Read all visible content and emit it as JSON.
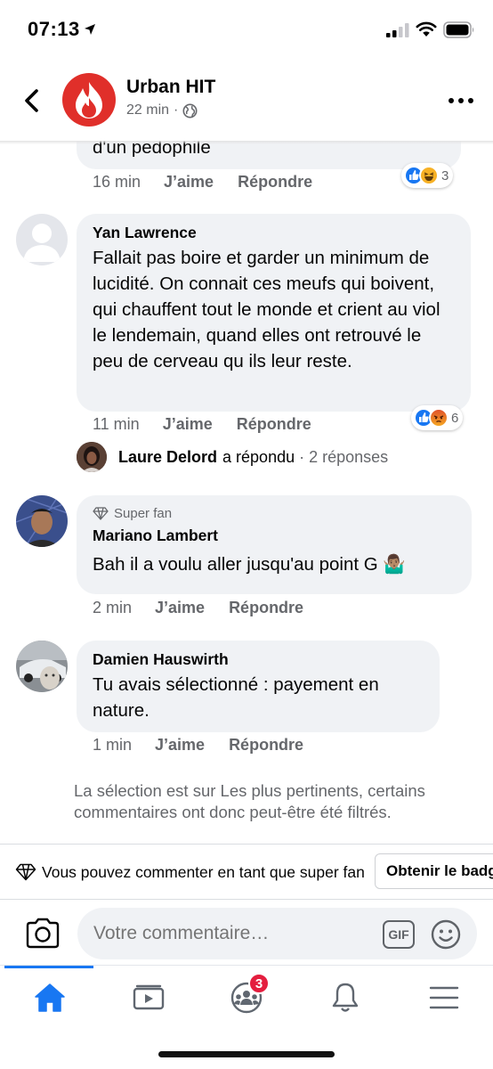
{
  "status_bar": {
    "time": "07:13"
  },
  "header": {
    "page_name": "Urban HIT",
    "post_age": "22 min",
    "separator": "·"
  },
  "comments": [
    {
      "author": "",
      "text": "d'un pedophile",
      "time": "16 min",
      "like_label": "J’aime",
      "reply_label": "Répondre",
      "reactions": [
        "like",
        "haha"
      ],
      "reaction_count": "3"
    },
    {
      "author": "Yan Lawrence",
      "text": "Fallait pas boire et garder un minimum de lucidité. On connait ces meufs qui boivent, qui chauffent tout le monde et crient au viol le lendemain, quand elles ont retrouvé le peu de cerveau qu ils leur reste.",
      "time": "11 min",
      "like_label": "J’aime",
      "reply_label": "Répondre",
      "reactions": [
        "like",
        "angry"
      ],
      "reaction_count": "6",
      "replies_preview": {
        "name": "Laure Delord",
        "action": "a répondu",
        "separator": "·",
        "count": "2 réponses"
      }
    },
    {
      "badge": "Super fan",
      "author": "Mariano Lambert",
      "text": "Bah il a voulu aller jusqu'au point G 🤷🏽‍♂️",
      "time": "2 min",
      "like_label": "J’aime",
      "reply_label": "Répondre"
    },
    {
      "author": "Damien Hauswirth",
      "text": "Tu avais sélectionné : payement en nature.",
      "time": "1 min",
      "like_label": "J’aime",
      "reply_label": "Répondre"
    }
  ],
  "filter_note": "La sélection est sur Les plus pertinents, certains commentaires ont donc peut-être été filtrés.",
  "superfan_bar": {
    "text": "Vous pouvez commenter en tant que super fan",
    "button": "Obtenir le badge"
  },
  "composer": {
    "placeholder": "Votre commentaire…",
    "gif_label": "GIF"
  },
  "tabs": {
    "active": "home",
    "groups_badge": "3"
  },
  "colors": {
    "accent": "#1877f2",
    "bubble": "#f0f2f5",
    "secondary_text": "#65676b",
    "badge_red": "#e41e3f"
  }
}
